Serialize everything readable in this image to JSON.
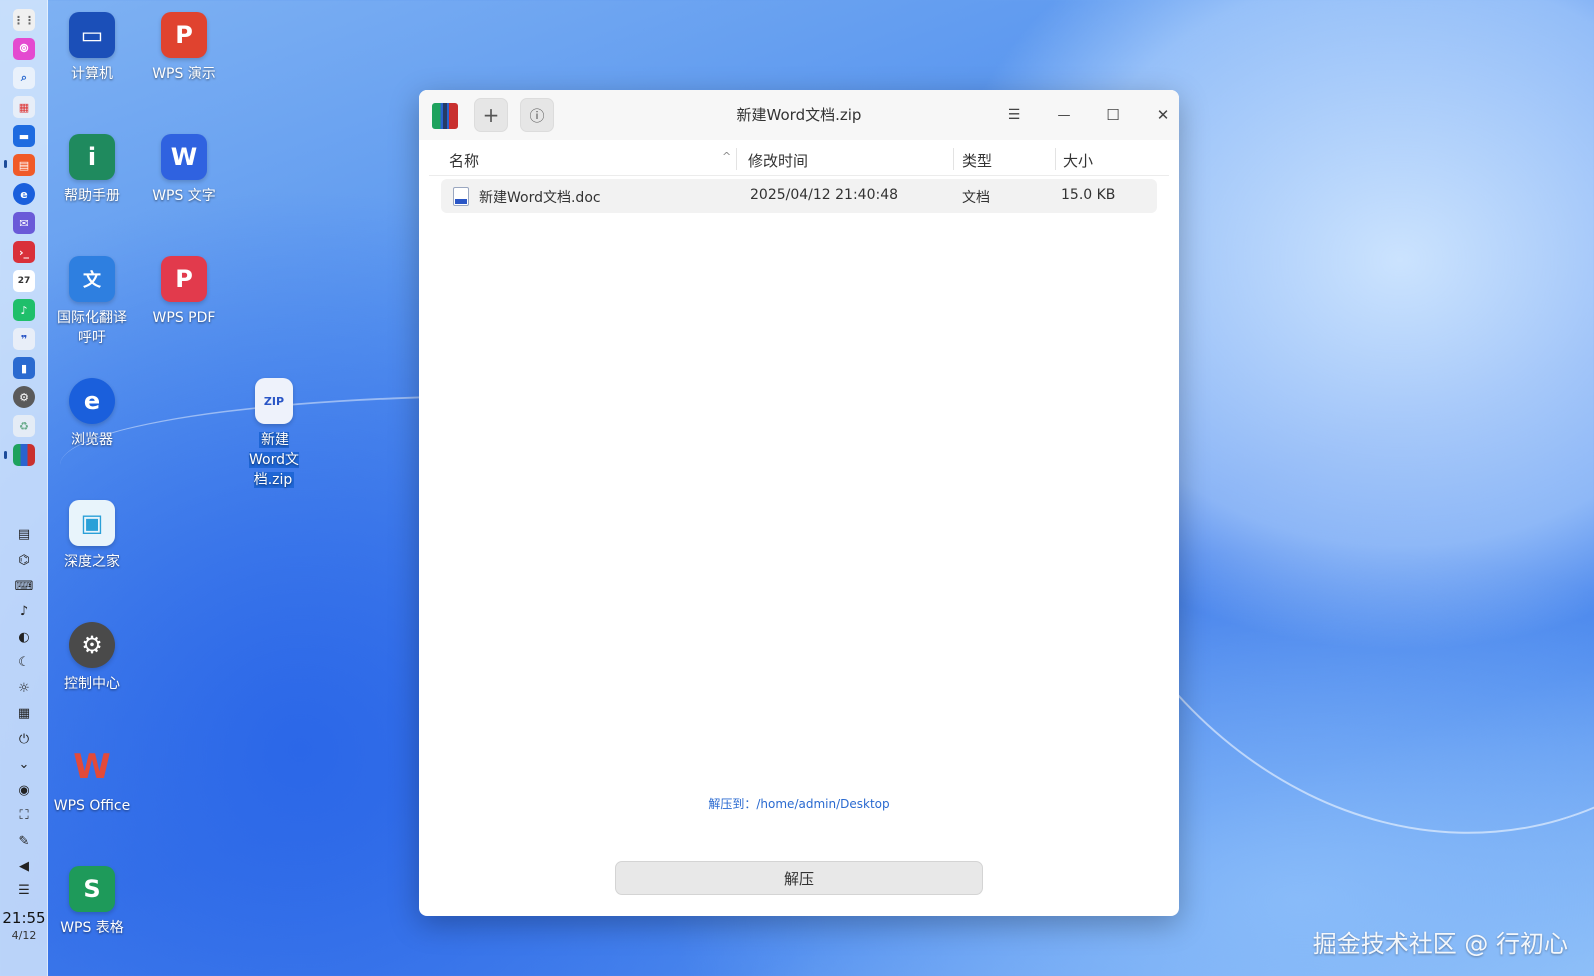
{
  "desktop": {
    "icons": [
      {
        "label": "计算机",
        "glyph": "▭",
        "color": "#1b4fb8",
        "icon": "computer-icon"
      },
      {
        "label": "WPS 演示",
        "glyph": "P",
        "color": "#e0432f",
        "icon": "wps-presentation-icon"
      },
      {
        "label": "帮助手册",
        "glyph": "i",
        "color": "#1f8a5e",
        "icon": "manual-icon"
      },
      {
        "label": "WPS 文字",
        "glyph": "W",
        "color": "#2f62e0",
        "icon": "wps-writer-icon"
      },
      {
        "label": "国际化翻译呼吁",
        "glyph": "文",
        "color": "#2e7fe0",
        "icon": "translate-icon"
      },
      {
        "label": "WPS PDF",
        "glyph": "P",
        "color": "#e23a4c",
        "icon": "wps-pdf-icon"
      },
      {
        "label": "浏览器",
        "glyph": "e",
        "color": "#1a5fdc",
        "icon": "browser-icon"
      },
      {
        "label": "新建Word文档.zip",
        "glyph": "ZIP",
        "color": "#2a56c6",
        "icon": "zip-file-icon"
      },
      {
        "label": "深度之家",
        "glyph": "▣",
        "color": "#2aa0d8",
        "icon": "deepin-home-icon"
      },
      {
        "label": "控制中心",
        "glyph": "⚙",
        "color": "#4a4a4a",
        "icon": "control-center-icon"
      },
      {
        "label": "WPS Office",
        "glyph": "W",
        "color": "#e24a3a",
        "icon": "wps-office-icon"
      },
      {
        "label": "WPS 表格",
        "glyph": "S",
        "color": "#1e9a5a",
        "icon": "wps-spreadsheet-icon"
      }
    ]
  },
  "dock": {
    "time": "21:55",
    "date": "4/12"
  },
  "window": {
    "title": "新建Word文档.zip",
    "add_glyph": "+",
    "info_glyph": "ⓘ",
    "menu_glyph": "☰",
    "minimize_glyph": "—",
    "maximize_glyph": "☐",
    "close_glyph": "✕",
    "columns": {
      "name": "名称",
      "modified": "修改时间",
      "type": "类型",
      "size": "大小"
    },
    "rows": [
      {
        "name": "新建Word文档.doc",
        "modified": "2025/04/12 21:40:48",
        "type": "文档",
        "size": "15.0 KB"
      }
    ],
    "extract_to_label": "解压到：",
    "extract_to_path": "/home/admin/Desktop",
    "extract_button": "解压"
  },
  "watermark": "掘金技术社区 @ 行初心"
}
